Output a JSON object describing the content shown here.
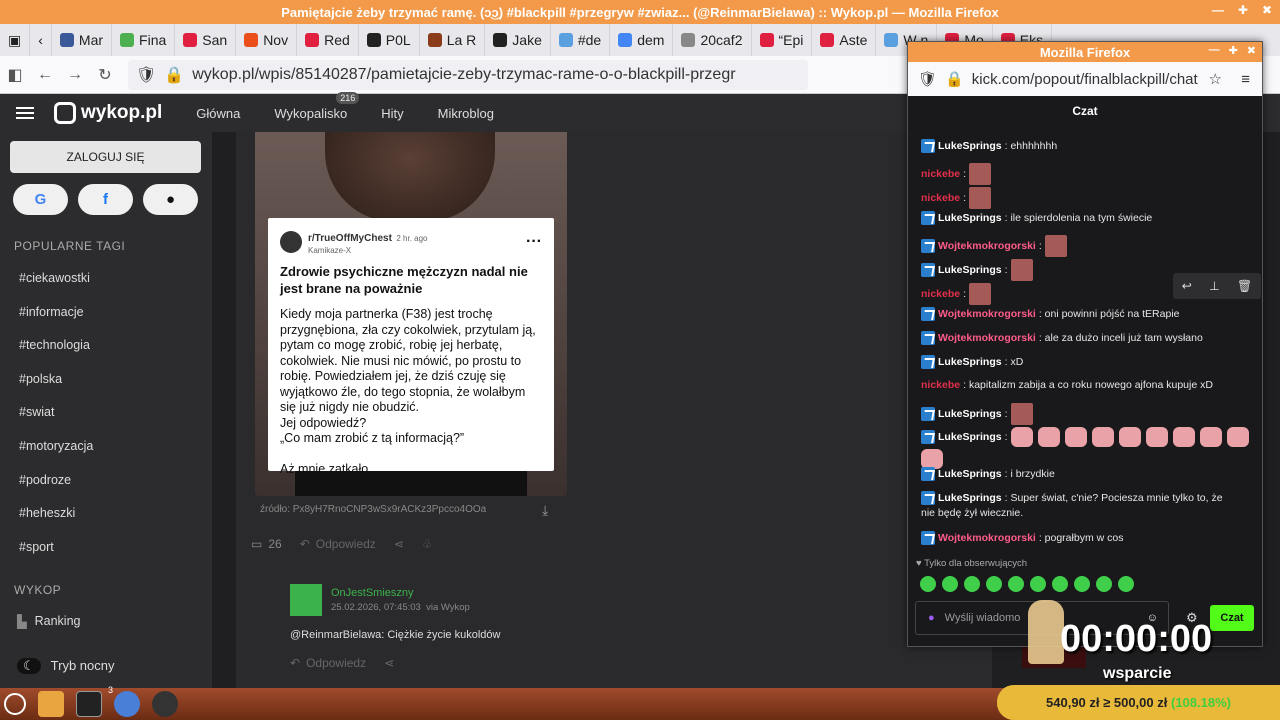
{
  "window": {
    "title": "Pamiętajcie żeby trzymać ramę. (ↄ͜ↄ) #blackpill #przegryw #zwiaz... (@ReinmarBielawa) :: Wykop.pl — Mozilla Firefox"
  },
  "tabs": [
    {
      "label": "Mar",
      "color": "#3b5998"
    },
    {
      "label": "Fina",
      "color": "#4caf50"
    },
    {
      "label": "San",
      "color": "#e02040"
    },
    {
      "label": "Nov",
      "color": "#e94e1b"
    },
    {
      "label": "Red",
      "color": "#e02040"
    },
    {
      "label": "P0L",
      "color": "#222222"
    },
    {
      "label": "La R",
      "color": "#8b3a1a"
    },
    {
      "label": "Jake",
      "color": "#222222"
    },
    {
      "label": "#de",
      "color": "#5aa0e0"
    },
    {
      "label": "dem",
      "color": "#4285f4"
    },
    {
      "label": "20caf2",
      "color": "#888888"
    },
    {
      "label": "“Epi",
      "color": "#e02040"
    },
    {
      "label": "Aste",
      "color": "#e02040"
    },
    {
      "label": "W n",
      "color": "#5aa0e0"
    },
    {
      "label": "Mo",
      "color": "#e02040"
    },
    {
      "label": "Eks",
      "color": "#e02040"
    }
  ],
  "address": {
    "url": "wykop.pl/wpis/85140287/pamietajcie-zeby-trzymac-rame-o-o-blackpill-przegr"
  },
  "wykop": {
    "logo": "wykop.pl",
    "nav": [
      "Główna",
      "Wykopalisko",
      "Hity",
      "Mikroblog"
    ],
    "badge": "216"
  },
  "sidebar": {
    "login": "ZALOGUJ SIĘ",
    "section_tags": "POPULARNE TAGI",
    "tags": [
      "#ciekawostki",
      "#informacje",
      "#technologia",
      "#polska",
      "#swiat",
      "#motoryzacja",
      "#podroze",
      "#heheszki",
      "#sport"
    ],
    "section_wykop": "WYKOP",
    "ranking": "Ranking",
    "night": "Tryb nocny"
  },
  "post": {
    "card_sub": "r/TrueOffMyChest",
    "card_time": "2 hr. ago",
    "card_user": "Kamikaze-X",
    "card_title": "Zdrowie psychiczne mężczyzn nadal nie jest brane na poważnie",
    "card_body": "Kiedy moja partnerka (F38) jest trochę przygnębiona, zła czy cokolwiek, przytulam ją, pytam co mogę zrobić, robię jej herbatę, cokolwiek. Nie musi nic mówić, po prostu to robię. Powiedziałem jej, że dziś czuję się wyjątkowo źle, do tego stopnia, że wolałbym się już nigdy nie obudzić.\nJej odpowiedź?\n„Co mam zrobić z tą informacją?”\n\nAż mnie zatkało.",
    "source": "źródło: Px8yH7RnoCNP3wSx9rACKz3Ppcco4OOa",
    "comments": "26",
    "reply": "Odpowiedz"
  },
  "comment": {
    "user": "OnJestSmieszny",
    "date": "25.02.2026, 07:45:03",
    "via": "via Wykop",
    "text": "@ReinmarBielawa: Ciężkie życie kukoldów",
    "reply": "Odpowiedz"
  },
  "popup": {
    "title": "Mozilla Firefox",
    "url": "kick.com/popout/finalblackpill/chat",
    "chat_title": "Czat",
    "followers_only": "Tylko dla obserwujących",
    "input_placeholder": "Wyślij wiadomo",
    "send": "Czat"
  },
  "chat": [
    {
      "user": "LukeSprings",
      "color": "#ffffff",
      "badge": true,
      "text": ": ehhhhhhh",
      "emotes": 0
    },
    {
      "user": "nickebe",
      "color": "#e0304c",
      "badge": false,
      "text": ":",
      "emotes": 1
    },
    {
      "user": "nickebe",
      "color": "#e0304c",
      "badge": false,
      "text": ":",
      "emotes": 1
    },
    {
      "user": "LukeSprings",
      "color": "#ffffff",
      "badge": true,
      "text": ": ile spierdolenia na tym świecie",
      "emotes": 0
    },
    {
      "user": "Wojtekmokrogorski",
      "color": "#ff5c8a",
      "badge": true,
      "text": ":",
      "emotes": 1
    },
    {
      "user": "LukeSprings",
      "color": "#ffffff",
      "badge": true,
      "text": ":",
      "emotes": 1
    },
    {
      "user": "nickebe",
      "color": "#e0304c",
      "badge": false,
      "text": ":",
      "emotes": 1
    },
    {
      "user": "Wojtekmokrogorski",
      "color": "#ff5c8a",
      "badge": true,
      "text": ": oni powinni pójść na tERapie",
      "emotes": 0
    },
    {
      "user": "Wojtekmokrogorski",
      "color": "#ff5c8a",
      "badge": true,
      "text": ": ale za dużo inceli już tam wysłano",
      "emotes": 0
    },
    {
      "user": "LukeSprings",
      "color": "#ffffff",
      "badge": true,
      "text": ": xD",
      "emotes": 0
    },
    {
      "user": "nickebe",
      "color": "#e0304c",
      "badge": false,
      "text": ": kapitalizm zabija a co roku nowego ajfona kupuje xD",
      "emotes": 0
    },
    {
      "user": "LukeSprings",
      "color": "#ffffff",
      "badge": true,
      "text": ":",
      "emotes": 1
    },
    {
      "user": "LukeSprings",
      "color": "#ffffff",
      "badge": true,
      "text": ":",
      "emotes": 10
    },
    {
      "user": "LukeSprings",
      "color": "#ffffff",
      "badge": true,
      "text": ": i brzydkie",
      "emotes": 0
    },
    {
      "user": "LukeSprings",
      "color": "#ffffff",
      "badge": true,
      "text": ": Super świat, c'nie? Pociesza mnie tylko to, że",
      "emotes": 0
    },
    {
      "user": "",
      "color": "#ffffff",
      "badge": false,
      "text": "nie będę żył wiecznie.",
      "emotes": 0
    },
    {
      "user": "Wojtekmokrogorski",
      "color": "#ff5c8a",
      "badge": true,
      "text": ": pograłbym w cos",
      "emotes": 0
    }
  ],
  "overlay": {
    "timer": "00:00:00",
    "wsparcie": "wsparcie",
    "progress_text": "540,90 zł ≥ 500,00 zł",
    "progress_pct": "(108.18%)",
    "progress_value": 1.0
  },
  "taskbar": {
    "badge": "3"
  }
}
